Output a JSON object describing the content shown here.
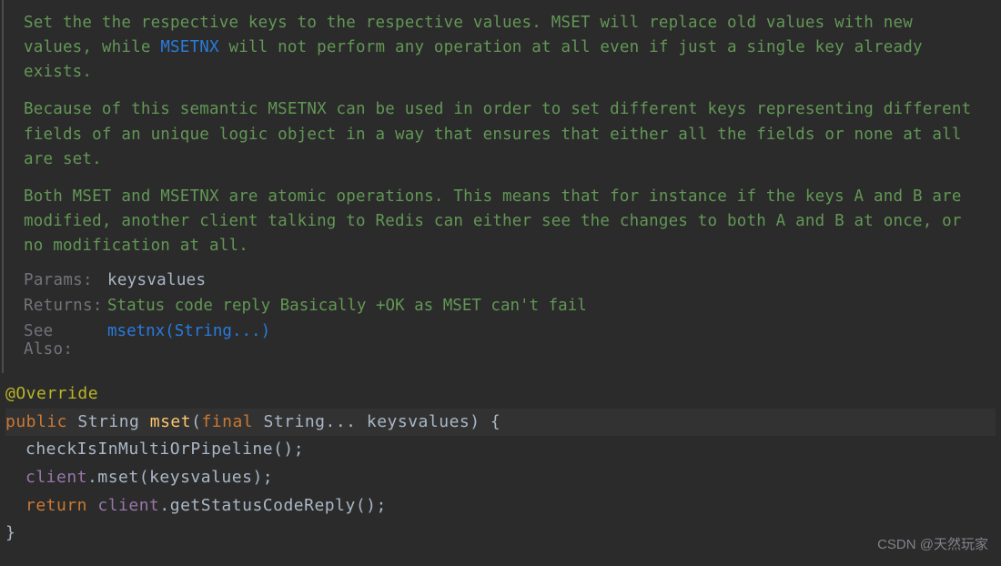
{
  "javadoc": {
    "para1_before_link": "Set the the respective keys to the respective values. MSET will replace old values with new values, while ",
    "para1_link": "MSETNX",
    "para1_after_link": " will not perform any operation at all even if just a single key already exists.",
    "para2": "Because of this semantic MSETNX can be used in order to set different keys representing different fields of an unique logic object in a way that ensures that either all the fields or none at all are set.",
    "para3": "Both MSET and MSETNX are atomic operations. This means that for instance if the keys A and B are modified, another client talking to Redis can either see the changes to both A and B at once, or no modification at all.",
    "tags": {
      "params_label": "Params:",
      "params_value": "keysvalues",
      "returns_label": "Returns:",
      "returns_value": "Status code reply Basically +OK as MSET can't fail",
      "seealso_label": "See Also:",
      "seealso_value": "msetnx(String...)"
    }
  },
  "code": {
    "annotation": "@Override",
    "kw_public": "public",
    "ret_type": "String",
    "method_name": "mset",
    "kw_final": "final",
    "param_type": "String...",
    "param_name": "keysvalues",
    "line2_call": "checkIsInMultiOrPipeline",
    "line3_obj": "client",
    "line3_call": "mset",
    "line3_arg": "keysvalues",
    "kw_return": "return",
    "line4_obj": "client",
    "line4_call": "getStatusCodeReply"
  },
  "watermark": "CSDN @天然玩家"
}
